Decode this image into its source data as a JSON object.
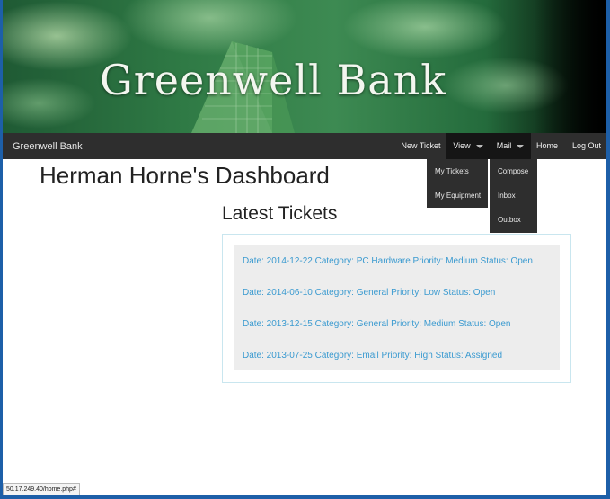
{
  "banner": {
    "logo_text": "Greenwell Bank"
  },
  "navbar": {
    "brand": "Greenwell Bank",
    "items": {
      "new_ticket": "New Ticket",
      "view": "View",
      "mail": "Mail",
      "home": "Home",
      "logout": "Log Out"
    },
    "view_menu": [
      "My Tickets",
      "My Equipment"
    ],
    "mail_menu": [
      "Compose",
      "Inbox",
      "Outbox"
    ]
  },
  "main": {
    "page_title": "Herman Horne's Dashboard",
    "section_title": "Latest Tickets",
    "tickets": [
      "Date: 2014-12-22 Category: PC Hardware Priority: Medium Status: Open",
      "Date: 2014-06-10 Category: General Priority: Low Status: Open",
      "Date: 2013-12-15 Category: General Priority: Medium Status: Open",
      "Date: 2013-07-25 Category: Email Priority: High Status: Assigned"
    ]
  },
  "status_bar": {
    "url": "50.17.249.40/home.php#"
  },
  "colors": {
    "navbar": "#2e2e2e",
    "link": "#3a9ad0",
    "panel_border": "#c9e6ef",
    "panel_fill": "#ededed",
    "window_frame": "#1d5fa8"
  }
}
